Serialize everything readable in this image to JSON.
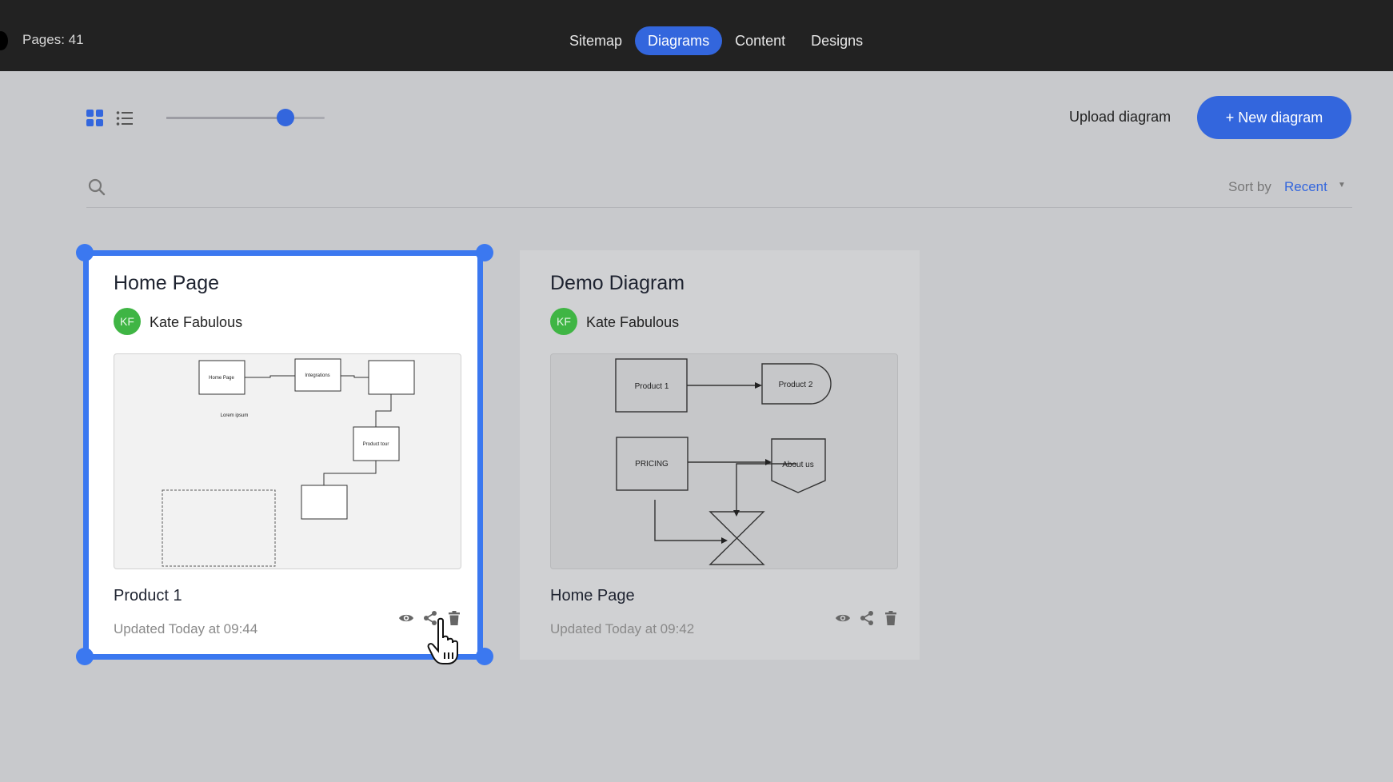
{
  "header": {
    "pages_label": "Pages: 41",
    "tabs": [
      {
        "label": "Sitemap",
        "active": false
      },
      {
        "label": "Diagrams",
        "active": true
      },
      {
        "label": "Content",
        "active": false
      },
      {
        "label": "Designs",
        "active": false
      }
    ]
  },
  "toolbar": {
    "grid_view_icon": "grid-icon",
    "list_view_icon": "list-icon",
    "zoom_slider_level": 0.75,
    "upload_label": "Upload diagram",
    "new_label": "+ New diagram"
  },
  "search": {
    "value": "",
    "placeholder": "",
    "sort_label": "Sort by",
    "sort_value": "Recent"
  },
  "colors": {
    "accent": "#3366dd",
    "selection": "#3b78f0",
    "avatar": "#3fb544",
    "topbar": "#222222",
    "background": "#c8c9cc"
  },
  "cards": [
    {
      "title": "Home Page",
      "author_initials": "KF",
      "author": "Kate Fabulous",
      "name": "Product 1",
      "updated": "Updated Today at 09:44",
      "selected": true,
      "thumb_labels": [
        "Home Page",
        "Integrations",
        "Lorem ipsum",
        "Product tour"
      ]
    },
    {
      "title": "Demo Diagram",
      "author_initials": "KF",
      "author": "Kate Fabulous",
      "name": "Home Page",
      "updated": "Updated Today at 09:42",
      "selected": false,
      "thumb_labels": [
        "Product 1",
        "Product 2",
        "PRICING",
        "About us"
      ]
    }
  ]
}
